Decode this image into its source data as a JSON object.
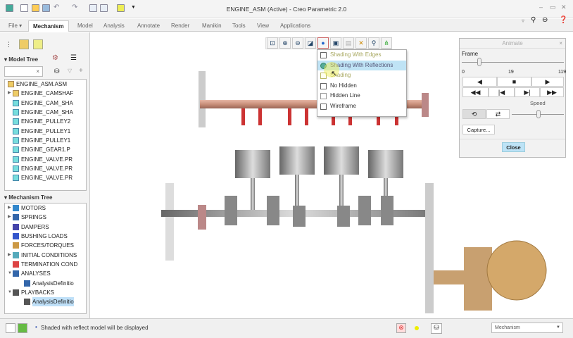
{
  "window": {
    "title": "ENGINE_ASM (Active) - Creo Parametric 2.0",
    "controls": [
      "minimize",
      "restore",
      "close"
    ]
  },
  "ribbon": {
    "file_label": "File",
    "tabs": [
      "Mechanism",
      "Model",
      "Analysis",
      "Annotate",
      "Render",
      "Manikin",
      "Tools",
      "View",
      "Applications"
    ],
    "active_tab": "Mechanism"
  },
  "model_tree": {
    "title": "Model Tree",
    "search_value": "",
    "items": [
      "ENGINE_ASM.ASM",
      "ENGINE_CAMSHAF",
      "ENGINE_CAM_SHA",
      "ENGINE_CAM_SHA",
      "ENGINE_PULLEY2",
      "ENGINE_PULLEY1",
      "ENGINE_PULLEY1",
      "ENGINE_GEAR1.P",
      "ENGINE_VALVE.PR",
      "ENGINE_VALVE.PR",
      "ENGINE_VALVE.PR"
    ]
  },
  "mechanism_tree": {
    "title": "Mechanism Tree",
    "items": [
      "MOTORS",
      "SPRINGS",
      "DAMPERS",
      "BUSHING LOADS",
      "FORCES/TORQUES",
      "INITIAL CONDITIONS",
      "TERMINATION COND",
      "ANALYSES",
      "AnalysisDefinitio",
      "PLAYBACKS",
      "AnalysisDefinitio"
    ]
  },
  "display_menu": {
    "items": [
      "Shading With Edges",
      "Shading With Reflections",
      "Shading",
      "No Hidden",
      "Hidden Line",
      "Wireframe"
    ],
    "highlighted": "Shading With Reflections"
  },
  "animate": {
    "title": "Animate",
    "frame_label": "Frame",
    "frame_min": "0",
    "frame_value": "19",
    "frame_max": "119",
    "speed_label": "Speed",
    "speed_fraction": 0.5,
    "capture_label": "Capture...",
    "close_label": "Close"
  },
  "status": {
    "message": "Shaded with reflect model will be displayed",
    "filter_value": "Mechanism"
  },
  "colors": {
    "accent": "#2a7bd0",
    "highlight": "#bfe3f5",
    "shaft": "#c98f7a",
    "gear": "#d4a86a"
  }
}
